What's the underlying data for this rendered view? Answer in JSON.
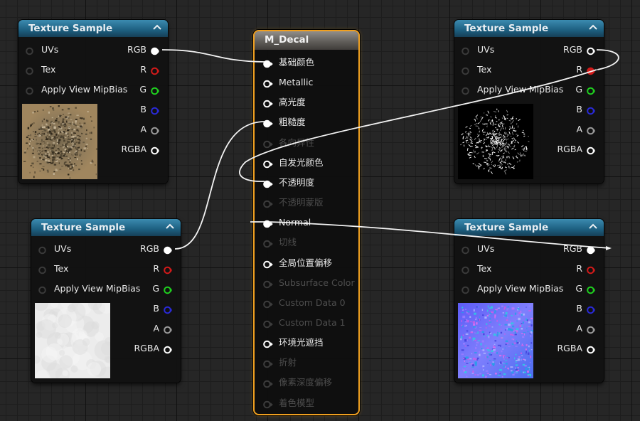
{
  "texture_samples": [
    {
      "title": "Texture Sample",
      "inputs": [
        "UVs",
        "Tex",
        "Apply View MipBias"
      ],
      "outputs": [
        "RGB",
        "R",
        "G",
        "B",
        "A",
        "RGBA"
      ],
      "preview": "noise-brown-texture"
    },
    {
      "title": "Texture Sample",
      "inputs": [
        "UVs",
        "Tex",
        "Apply View MipBias"
      ],
      "outputs": [
        "RGB",
        "R",
        "G",
        "B",
        "A",
        "RGBA"
      ],
      "preview": "white-soft-texture"
    },
    {
      "title": "Texture Sample",
      "inputs": [
        "UVs",
        "Tex",
        "Apply View MipBias"
      ],
      "outputs": [
        "RGB",
        "R",
        "G",
        "B",
        "A",
        "RGBA"
      ],
      "preview": "bw-mask-texture"
    },
    {
      "title": "Texture Sample",
      "inputs": [
        "UVs",
        "Tex",
        "Apply View MipBias"
      ],
      "outputs": [
        "RGB",
        "R",
        "G",
        "B",
        "A",
        "RGBA"
      ],
      "preview": "normal-map-texture"
    }
  ],
  "material": {
    "title": "M_Decal",
    "inputs": [
      {
        "label": "基础颜色",
        "enabled": true,
        "connected": true
      },
      {
        "label": "Metallic",
        "enabled": true,
        "connected": false
      },
      {
        "label": "高光度",
        "enabled": true,
        "connected": false
      },
      {
        "label": "粗糙度",
        "enabled": true,
        "connected": true
      },
      {
        "label": "各向异性",
        "enabled": false,
        "connected": false
      },
      {
        "label": "自发光颜色",
        "enabled": true,
        "connected": false
      },
      {
        "label": "不透明度",
        "enabled": true,
        "connected": true
      },
      {
        "label": "不透明蒙版",
        "enabled": false,
        "connected": false
      },
      {
        "label": "Normal",
        "enabled": true,
        "connected": true
      },
      {
        "label": "切线",
        "enabled": false,
        "connected": false
      },
      {
        "label": "全局位置偏移",
        "enabled": true,
        "connected": false
      },
      {
        "label": "Subsurface Color",
        "enabled": false,
        "connected": false
      },
      {
        "label": "Custom Data 0",
        "enabled": false,
        "connected": false
      },
      {
        "label": "Custom Data 1",
        "enabled": false,
        "connected": false
      },
      {
        "label": "环境光遮挡",
        "enabled": true,
        "connected": false
      },
      {
        "label": "折射",
        "enabled": false,
        "connected": false
      },
      {
        "label": "像素深度偏移",
        "enabled": false,
        "connected": false
      },
      {
        "label": "着色模型",
        "enabled": false,
        "connected": false
      }
    ]
  },
  "colors": {
    "graph_bg": "#262626",
    "node_header": "#1d5f80",
    "material_header": "#615e5a",
    "selection_outline": "#f0a020",
    "pin_red": "#d21a1a",
    "pin_green": "#1fd01f",
    "pin_blue": "#2a2ad8",
    "pin_white": "#ffffff",
    "pin_grey": "#9a9a9a"
  }
}
